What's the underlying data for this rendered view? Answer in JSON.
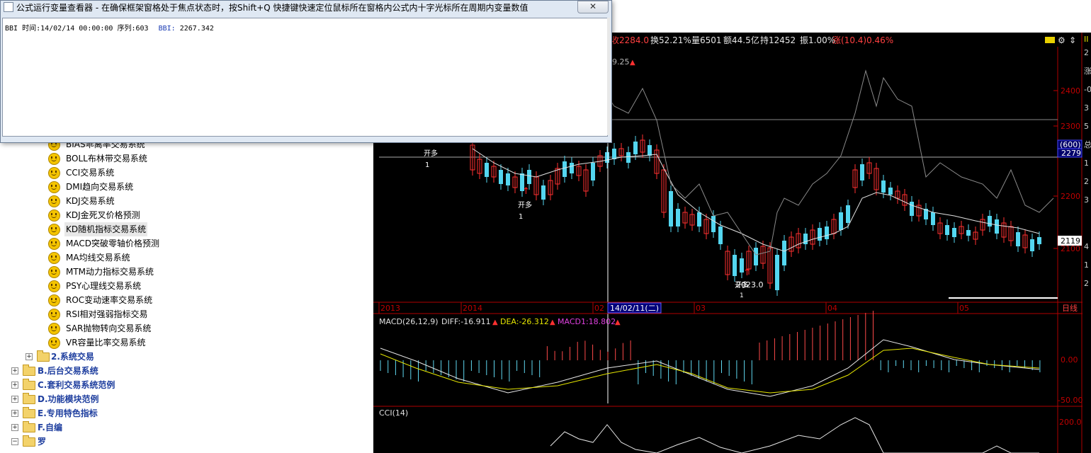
{
  "popup": {
    "title": "公式运行变量查看器 - 在确保框架窗格处于焦点状态时，按Shift+Q 快捷键快速定位鼠标所在窗格内公式内十字光标所在周期内变量数值",
    "close_label": "✕",
    "line_prefix": "BBI 时间:14/02/14 00:00:00 序列:603",
    "var_name": "BBI:",
    "var_value": "2267.342"
  },
  "tree": {
    "items": [
      {
        "label": "BIAS乖离率交易系统"
      },
      {
        "label": "BOLL布林带交易系统"
      },
      {
        "label": "CCI交易系统"
      },
      {
        "label": "DMI趋向交易系统"
      },
      {
        "label": "KDJ交易系统"
      },
      {
        "label": "KDJ金死叉价格预测"
      },
      {
        "label": "KD随机指标交易系统"
      },
      {
        "label": "MACD突破零轴价格预测"
      },
      {
        "label": "MA均线交易系统"
      },
      {
        "label": "MTM动力指标交易系统"
      },
      {
        "label": "PSY心理线交易系统"
      },
      {
        "label": "ROC变动速率交易系统"
      },
      {
        "label": "RSI相对强弱指标交易"
      },
      {
        "label": "SAR抛物转向交易系统"
      },
      {
        "label": "VR容量比率交易系统"
      }
    ],
    "sub_folder": "2.系统交易",
    "categories": [
      {
        "label": "B.后台交易系统"
      },
      {
        "label": "C.套利交易系统范例"
      },
      {
        "label": "D.功能模块范例"
      },
      {
        "label": "E.专用特色指标"
      },
      {
        "label": "F.自编"
      },
      {
        "label": "罗"
      }
    ]
  },
  "chart": {
    "info_bar": {
      "close": "收2284.0",
      "turnover": "换52.21%",
      "volume": "量6501",
      "amount": "额44.5亿",
      "open_interest": "持12452",
      "amplitude": "振1.00%",
      "change": "涨(10.4)0.46%"
    },
    "high_marker": "9.25",
    "price_ticks": [
      "2400",
      "2300",
      "2200",
      "2100"
    ],
    "line_tag_count": "(600)",
    "line_tag_value": "2279",
    "last_price": "2119",
    "signals": {
      "open_long_1": "开多",
      "open_long_1_qty": "1",
      "open_long_2": "开多",
      "open_long_2_qty": "1",
      "low_label": "2023.0",
      "low_open_long": "开多",
      "low_qty": "1"
    },
    "date_axis": [
      "2013",
      "2014",
      "02",
      "03",
      "04",
      "05"
    ],
    "cursor_date": "14/02/11(二)",
    "period": "日线",
    "right_edge_label": "II",
    "macd": {
      "name": "MACD(26,12,9)",
      "diff": "DIFF:-16.911",
      "dea": "DEA:-26.312",
      "macd1": "MACD1:18.802",
      "ticks": [
        "0.00",
        "-50.00"
      ]
    },
    "cci": {
      "name": "CCI(14)",
      "ticks": [
        "200.0"
      ]
    },
    "right_edge_chars": [
      "2",
      "涨",
      "-0",
      "3",
      "5",
      "总",
      "1",
      "2",
      "3",
      "4",
      "1",
      "2"
    ]
  }
}
